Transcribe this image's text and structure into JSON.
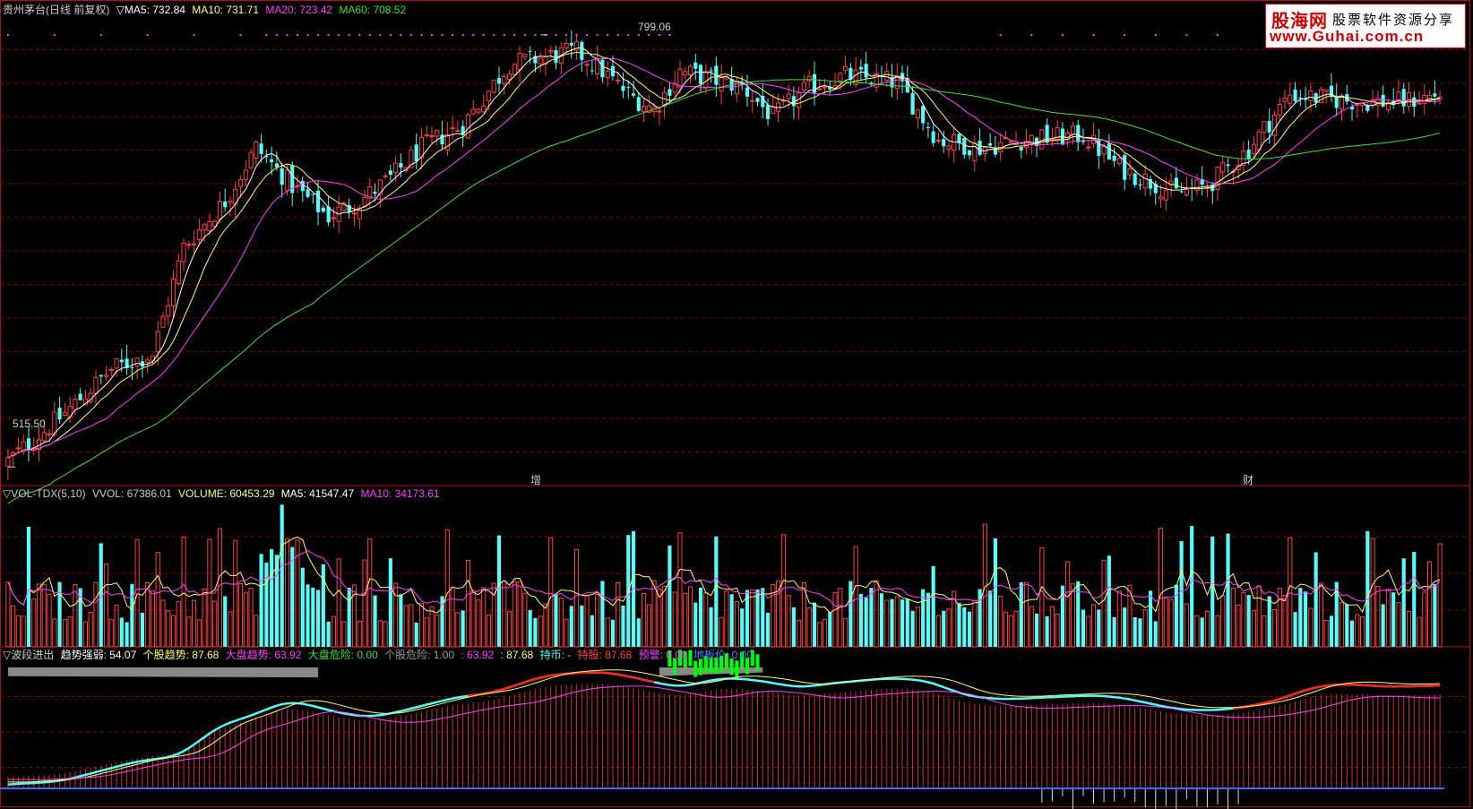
{
  "main_header": {
    "title": "贵州茅台(日线 前复权)",
    "ma5": "▽MA5: 732.84",
    "ma10": "MA10: 731.71",
    "ma20": "MA20: 723.42",
    "ma60": "MA60: 708.52"
  },
  "vol_header": {
    "name": "▽VOL-TDX(5,10)",
    "vvol": "VVOL: 67386.01",
    "volume": "VOLUME: 60453.29",
    "ma5": "MA5: 41547.47",
    "ma10": "MA10: 34173.61"
  },
  "ind_header": {
    "name": "▽波段进出",
    "strength": "趋势强弱: 54.07",
    "stock_trend": "个股趋势: 87.68",
    "market_trend": "大盘趋势: 63.92",
    "market_risk": "大盘危险: 0.00",
    "stock_risk": "个股危险: 1.00",
    "v1": ": 63.92",
    "v2": ": 87.68",
    "hold": "持币: -",
    "hold_stock": "持股: 87.68",
    "warn": "预警: 0.00",
    "floor": "地板价: 0.00"
  },
  "logo": {
    "line1": "股海网",
    "line2": "股票软件资源分享",
    "line3": "www.Guhai.com.cn"
  },
  "annotations": {
    "high": "799.06",
    "low": "515.50",
    "mark1": "增",
    "mark2": "财"
  },
  "colors": {
    "up": "#ff4040",
    "down": "#54fcfc",
    "ma5": "#ffffff",
    "ma10": "#ffff66",
    "ma20": "#ff40ff",
    "ma60": "#40e040",
    "grid": "#8b0000",
    "frame": "#b01010"
  },
  "chart_data": {
    "type": "candlestick",
    "y_range": [
      505,
      810
    ],
    "high": 799.06,
    "low": 515.5,
    "anchors": [
      [
        0,
        520
      ],
      [
        10,
        548
      ],
      [
        20,
        580
      ],
      [
        28,
        590
      ],
      [
        34,
        660
      ],
      [
        42,
        690
      ],
      [
        48,
        725
      ],
      [
        55,
        700
      ],
      [
        62,
        680
      ],
      [
        68,
        690
      ],
      [
        74,
        705
      ],
      [
        80,
        725
      ],
      [
        88,
        740
      ],
      [
        97,
        780
      ],
      [
        110,
        788
      ],
      [
        115,
        775
      ],
      [
        120,
        760
      ],
      [
        125,
        750
      ],
      [
        130,
        775
      ],
      [
        136,
        770
      ],
      [
        142,
        765
      ],
      [
        148,
        745
      ],
      [
        155,
        765
      ],
      [
        162,
        772
      ],
      [
        172,
        768
      ],
      [
        180,
        730
      ],
      [
        188,
        725
      ],
      [
        196,
        730
      ],
      [
        208,
        733
      ],
      [
        215,
        712
      ],
      [
        226,
        695
      ],
      [
        232,
        700
      ],
      [
        240,
        724
      ],
      [
        248,
        760
      ],
      [
        255,
        757
      ],
      [
        262,
        755
      ],
      [
        270,
        755
      ],
      [
        277,
        760
      ]
    ],
    "count": 278
  }
}
